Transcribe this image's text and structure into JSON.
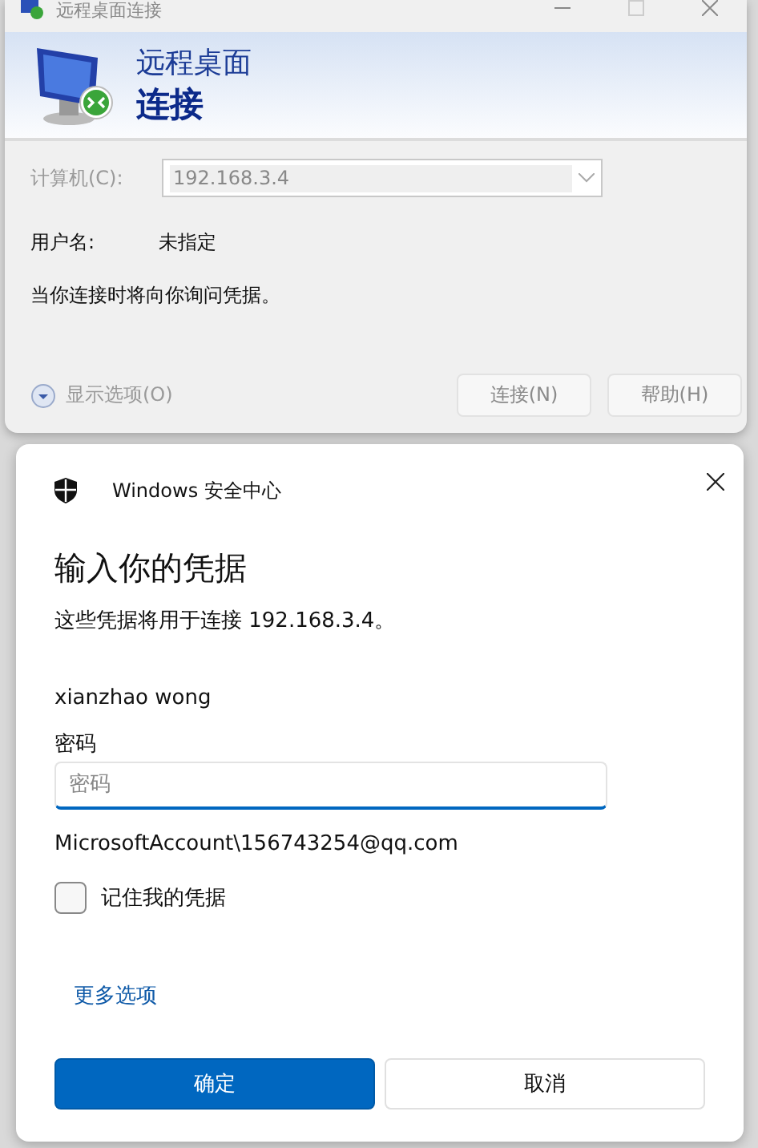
{
  "rdp_window": {
    "title": "远程桌面连接",
    "banner": {
      "line1": "远程桌面",
      "line2": "连接"
    },
    "computer": {
      "label": "计算机(C):",
      "value": "192.168.3.4",
      "disabled": true
    },
    "username": {
      "label": "用户名:",
      "value": "未指定"
    },
    "message": "当你连接时将向你询问凭据。",
    "show_options": {
      "label": "显示选项(O)",
      "disabled": true
    },
    "buttons": [
      {
        "label": "连接(N)",
        "disabled": true
      },
      {
        "label": "帮助(H)",
        "disabled": true
      }
    ]
  },
  "security_dialog": {
    "app_title": "Windows 安全中心",
    "heading": "输入你的凭据",
    "subtitle": "这些凭据将用于连接 192.168.3.4。",
    "user": "xianzhao wong",
    "password_label": "密码",
    "password_placeholder": "密码",
    "account": "MicrosoftAccount\\156743254@qq.com",
    "remember": {
      "label": "记住我的凭据",
      "checked": false
    },
    "more_options": "更多选项",
    "buttons": [
      {
        "label": "确定",
        "primary": true
      },
      {
        "label": "取消",
        "primary": false
      }
    ]
  }
}
